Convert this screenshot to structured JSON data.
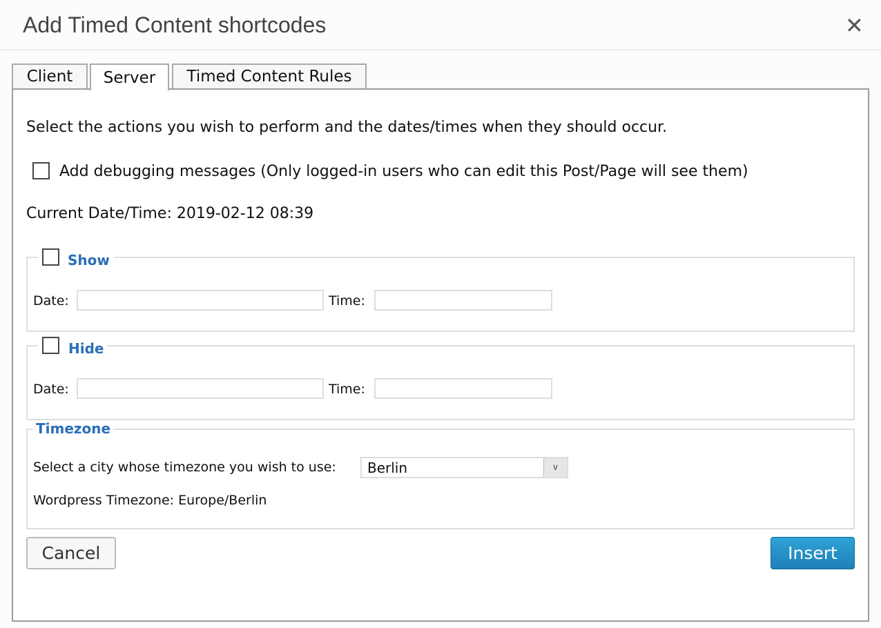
{
  "dialog": {
    "title": "Add Timed Content shortcodes",
    "close_icon": "close-icon"
  },
  "tabs": [
    {
      "label": "Client"
    },
    {
      "label": "Server",
      "active": true
    },
    {
      "label": "Timed Content Rules"
    }
  ],
  "main": {
    "intro": "Select the actions you wish to perform and the dates/times when they should occur.",
    "debug_label": "Add debugging messages (Only logged-in users who can edit this Post/Page will see them)",
    "debug_checked": false,
    "current_datetime": "Current Date/Time: 2019-02-12 08:39",
    "show": {
      "legend": "Show",
      "checked": false,
      "date_label": "Date:",
      "date_value": "",
      "time_label": "Time:",
      "time_value": ""
    },
    "hide": {
      "legend": "Hide",
      "checked": false,
      "date_label": "Date:",
      "date_value": "",
      "time_label": "Time:",
      "time_value": ""
    },
    "timezone": {
      "legend": "Timezone",
      "select_label": "Select a city whose timezone you wish to use:",
      "selected": "Berlin",
      "wp_timezone": "Wordpress Timezone: Europe/Berlin"
    }
  },
  "buttons": {
    "cancel": "Cancel",
    "insert": "Insert"
  },
  "colors": {
    "accent": "#2a6fb8",
    "insert_bg": "#2589c2"
  }
}
